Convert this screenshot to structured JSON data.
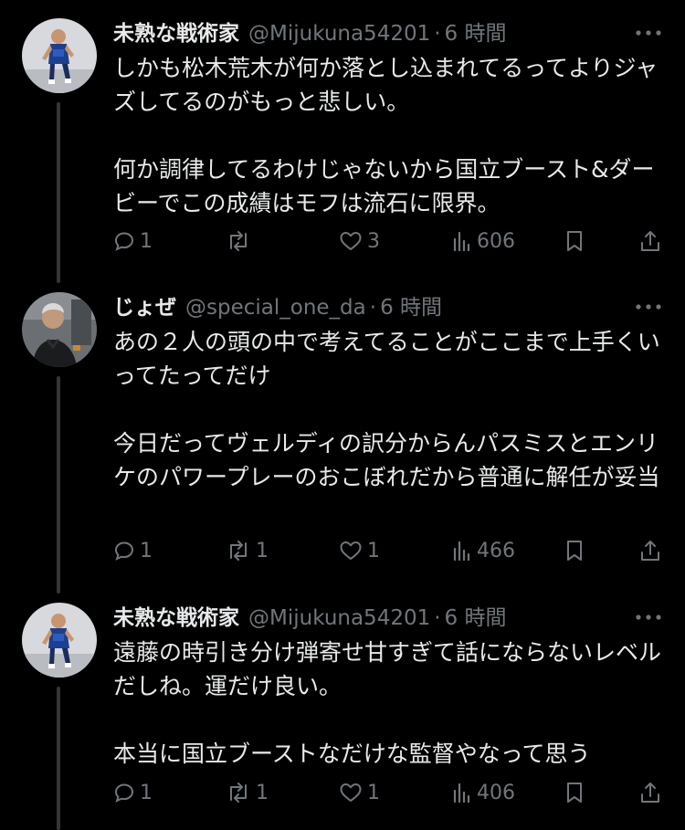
{
  "colors": {
    "background": "#000000",
    "text_primary": "#e7e9ea",
    "text_secondary": "#71767b",
    "thread_line": "#333639"
  },
  "tweets": [
    {
      "name": "未熟な戦術家",
      "handle": "@Mijukuna54201",
      "dot": "·",
      "time": "6 時間",
      "avatar_icon": "soccer-player-avatar",
      "paragraphs": [
        "しかも松木荒木が何か落とし込まれてるってよりジャズしてるのがもっと悲しい。",
        "何か調律してるわけじゃないから国立ブースト&ダービーでこの成績はモフは流石に限界。"
      ],
      "replies": "1",
      "retweets": "",
      "likes": "3",
      "views": "606"
    },
    {
      "name": "じょぜ",
      "handle": "@special_one_da",
      "dot": "·",
      "time": "6 時間",
      "avatar_icon": "coach-avatar",
      "paragraphs": [
        "あの２人の頭の中で考えてることがここまで上手くいってたってだけ",
        "今日だってヴェルディの訳分からんパスミスとエンリケのパワープレーのおこぼれだから普通に解任が妥当"
      ],
      "replies": "1",
      "retweets": "1",
      "likes": "1",
      "views": "466"
    },
    {
      "name": "未熟な戦術家",
      "handle": "@Mijukuna54201",
      "dot": "·",
      "time": "6 時間",
      "avatar_icon": "soccer-player-avatar",
      "paragraphs": [
        "遠藤の時引き分け弾寄せ甘すぎて話にならないレベルだしね。運だけ良い。",
        "本当に国立ブーストなだけな監督やなって思う"
      ],
      "replies": "1",
      "retweets": "1",
      "likes": "1",
      "views": "406"
    }
  ]
}
